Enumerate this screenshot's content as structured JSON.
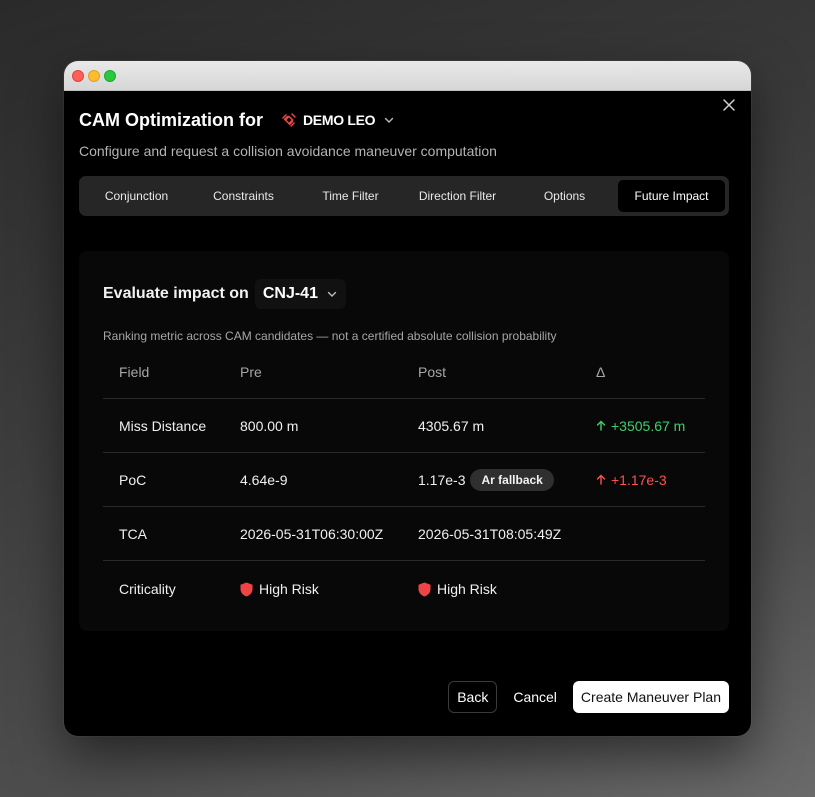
{
  "dialog": {
    "title": "CAM Optimization for",
    "satellite": "DEMO LEO",
    "subtitle": "Configure and request a collision avoidance maneuver computation"
  },
  "tabs": [
    {
      "label": "Conjunction",
      "active": false
    },
    {
      "label": "Constraints",
      "active": false
    },
    {
      "label": "Time Filter",
      "active": false
    },
    {
      "label": "Direction Filter",
      "active": false
    },
    {
      "label": "Options",
      "active": false
    },
    {
      "label": "Future Impact",
      "active": true
    }
  ],
  "impact": {
    "label": "Evaluate impact on",
    "conjunction": "CNJ-41",
    "note": "Ranking metric across CAM candidates — not a certified absolute collision probability"
  },
  "table": {
    "headers": [
      "Field",
      "Pre",
      "Post",
      "Δ"
    ],
    "rows": [
      {
        "field": "Miss Distance",
        "pre": "800.00 m",
        "post": "4305.67 m",
        "delta": "+3505.67 m",
        "delta_color": "#3ecf6e"
      },
      {
        "field": "PoC",
        "pre": "4.64e-9",
        "post": "1.17e-3",
        "post_badge": "Ar fallback",
        "delta": "+1.17e-3",
        "delta_color": "#ff5050"
      },
      {
        "field": "TCA",
        "pre": "2026-05-31T06:30:00Z",
        "post": "2026-05-31T08:05:49Z",
        "delta": ""
      },
      {
        "field": "Criticality",
        "pre": "High Risk",
        "post": "High Risk",
        "delta": "",
        "risk_color": "#ef4444"
      }
    ]
  },
  "footer": {
    "back": "Back",
    "cancel": "Cancel",
    "create": "Create Maneuver Plan"
  },
  "icons": {
    "satellite": "satellite-icon",
    "chevron": "chevron-down-icon",
    "close": "close-icon",
    "arrow": "arrow-up-icon",
    "shield": "shield-icon"
  }
}
